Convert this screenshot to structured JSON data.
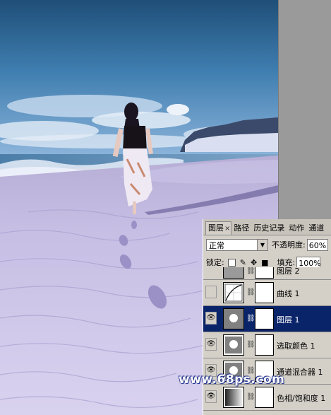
{
  "panel": {
    "tabs": [
      {
        "label": "图层",
        "close": "×"
      },
      {
        "label": "路径"
      },
      {
        "label": "历史记录"
      },
      {
        "label": "动作"
      },
      {
        "label": "通道"
      }
    ],
    "blend_mode": "正常",
    "opacity_label": "不透明度:",
    "opacity_value": "60%",
    "lock_label": "锁定:",
    "fill_label": "填充:",
    "fill_value": "100%",
    "layers": [
      {
        "name": "图层 2",
        "selected": false
      },
      {
        "name": "曲线 1",
        "selected": false
      },
      {
        "name": "图层 1",
        "selected": true
      },
      {
        "name": "选取颜色 1",
        "selected": false
      },
      {
        "name": "通道混合器 1",
        "selected": false
      },
      {
        "name": "色相/饱和度 1",
        "selected": false
      }
    ]
  },
  "watermark": "www.68ps.com",
  "colors": {
    "selected_layer": "#0a246a",
    "panel_bg": "#d4d0c8",
    "canvas_gray": "#9a9a9a"
  }
}
